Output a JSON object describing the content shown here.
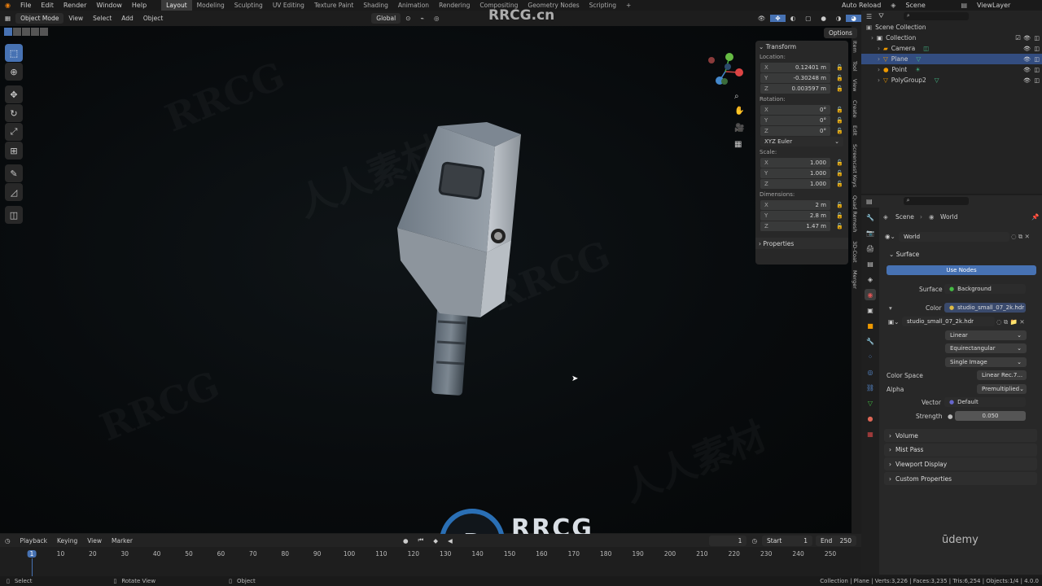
{
  "topbar": {
    "menus": [
      "File",
      "Edit",
      "Render",
      "Window",
      "Help"
    ],
    "workspaces": [
      "Layout",
      "Modeling",
      "Sculpting",
      "UV Editing",
      "Texture Paint",
      "Shading",
      "Animation",
      "Rendering",
      "Compositing",
      "Geometry Nodes",
      "Scripting",
      "+"
    ],
    "active_workspace": "Layout",
    "auto_reload": "Auto Reload",
    "scene": "Scene",
    "view_layer": "ViewLayer"
  },
  "viewport_header": {
    "mode": "Object Mode",
    "menus": [
      "View",
      "Select",
      "Add",
      "Object"
    ],
    "orientation": "Global",
    "options": "Options"
  },
  "watermark": {
    "site": "RRCG.cn",
    "logo_text": "RRCG",
    "logo_sub": "人人素材",
    "brand": "ūdemy"
  },
  "npanel": {
    "title": "Transform",
    "location_label": "Location:",
    "location": [
      {
        "axis": "X",
        "value": "0.12401 m"
      },
      {
        "axis": "Y",
        "value": "-0.30248 m"
      },
      {
        "axis": "Z",
        "value": "0.003597 m"
      }
    ],
    "rotation_label": "Rotation:",
    "rotation": [
      {
        "axis": "X",
        "value": "0°"
      },
      {
        "axis": "Y",
        "value": "0°"
      },
      {
        "axis": "Z",
        "value": "0°"
      }
    ],
    "rotation_mode": "XYZ Euler",
    "scale_label": "Scale:",
    "scale": [
      {
        "axis": "X",
        "value": "1.000"
      },
      {
        "axis": "Y",
        "value": "1.000"
      },
      {
        "axis": "Z",
        "value": "1.000"
      }
    ],
    "dimensions_label": "Dimensions:",
    "dimensions": [
      {
        "axis": "X",
        "value": "2 m"
      },
      {
        "axis": "Y",
        "value": "2.8 m"
      },
      {
        "axis": "Z",
        "value": "1.47 m"
      }
    ],
    "properties": "Properties"
  },
  "sidetabs": [
    "Item",
    "Tool",
    "View",
    "Create",
    "Edit",
    "Screencast Keys",
    "Quad Remesh",
    "3D-Coat",
    "Merger"
  ],
  "outliner": {
    "root": "Scene Collection",
    "items": [
      {
        "label": "Collection",
        "selected": false
      },
      {
        "label": "Camera",
        "selected": false
      },
      {
        "label": "Plane",
        "selected": true
      },
      {
        "label": "Point",
        "selected": false
      },
      {
        "label": "PolyGroup2",
        "selected": false
      }
    ]
  },
  "properties": {
    "breadcrumb_scene": "Scene",
    "breadcrumb_world": "World",
    "world_name": "World",
    "surface_section": "Surface",
    "use_nodes": "Use Nodes",
    "surface_label": "Surface",
    "surface_value": "Background",
    "color_label": "Color",
    "color_value": "studio_small_07_2k.hdr",
    "image_name": "studio_small_07_2k.hdr",
    "interp": "Linear",
    "projection": "Equirectangular",
    "source": "Single Image",
    "color_space_label": "Color Space",
    "color_space": "Linear Rec.7...",
    "alpha_label": "Alpha",
    "alpha": "Premultiplied",
    "vector_label": "Vector",
    "vector": "Default",
    "strength_label": "Strength",
    "strength": "0.050",
    "sections": [
      "Volume",
      "Mist Pass",
      "Viewport Display",
      "Custom Properties"
    ]
  },
  "timeline": {
    "menus": [
      "Playback",
      "Keying",
      "View",
      "Marker"
    ],
    "current_frame": "1",
    "start_label": "Start",
    "start": "1",
    "end_label": "End",
    "end": "250",
    "ticks": [
      "1",
      "10",
      "20",
      "30",
      "40",
      "50",
      "60",
      "70",
      "80",
      "90",
      "100",
      "110",
      "120",
      "130",
      "140",
      "150",
      "160",
      "170",
      "180",
      "190",
      "200",
      "210",
      "220",
      "230",
      "240",
      "250"
    ]
  },
  "statusbar": {
    "select": "Select",
    "rotate": "Rotate View",
    "object": "Object",
    "stats": "Collection | Plane | Verts:3,226 | Faces:3,235 | Tris:6,254 | Objects:1/4 | 4.0.0"
  },
  "colors": {
    "accent": "#4772b3",
    "selected_row": "#334d80"
  }
}
